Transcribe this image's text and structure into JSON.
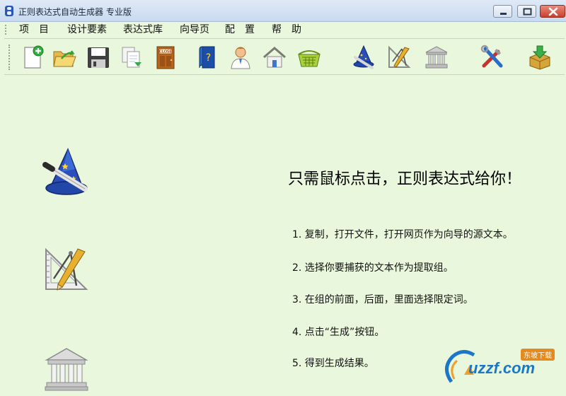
{
  "window": {
    "title": "正则表达式自动生成器 专业版"
  },
  "menu": [
    {
      "label": "项　目"
    },
    {
      "label": "设计要素"
    },
    {
      "label": "表达式库"
    },
    {
      "label": "向导页"
    },
    {
      "label": "配　置"
    },
    {
      "label": "帮　助"
    }
  ],
  "toolbar": {
    "icons": [
      "new-document-icon",
      "open-folder-icon",
      "save-disk-icon",
      "copy-pages-icon",
      "close-door-icon",
      "help-book-icon",
      "user-icon",
      "home-icon",
      "basket-icon",
      "wizard-hat-icon",
      "drafting-tools-icon",
      "library-building-icon",
      "tools-icon",
      "download-box-icon"
    ],
    "close_sign": "CLOSE"
  },
  "main": {
    "headline": "只需鼠标点击，正则表达式给你！",
    "steps": [
      "1. 复制，打开文件，打开网页作为向导的源文本。",
      "2. 选择你要捕获的文本作为提取组。",
      "3. 在组的前面，后面，里面选择限定词。",
      "4. 点击“生成”按钮。",
      "5. 得到生成结果。"
    ],
    "big_icons": [
      "wizard-hat-icon",
      "drafting-tools-icon",
      "library-building-icon"
    ]
  },
  "watermark": {
    "text": "uzzf.com",
    "badge": "东坡下载"
  },
  "colors": {
    "background": "#e9f7dc",
    "titlebar": "#c9daf0",
    "close_button": "#c9412c"
  }
}
